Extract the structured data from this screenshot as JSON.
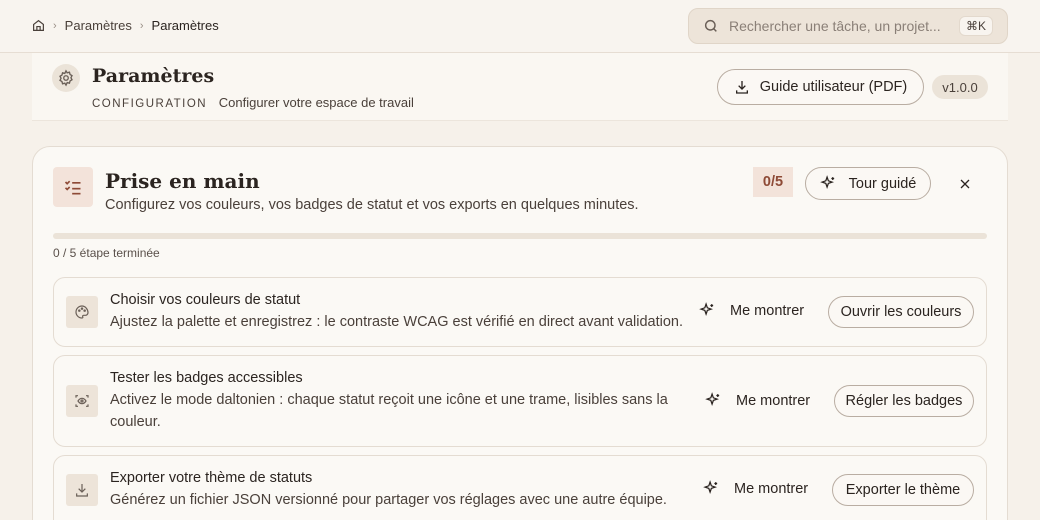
{
  "breadcrumb": {
    "items": [
      "Paramètres",
      "Paramètres"
    ]
  },
  "search": {
    "placeholder": "Rechercher une tâche, un projet...",
    "shortcut": "⌘K"
  },
  "header": {
    "title": "Paramètres",
    "caption": "CONFIGURATION",
    "subtitle": "Configurer votre espace de travail",
    "guide_label": "Guide utilisateur (PDF)",
    "version": "v1.0.0"
  },
  "onboarding": {
    "title": "Prise en main",
    "subtitle": "Configurez vos couleurs, vos badges de statut et vos exports en quelques minutes.",
    "count": "0/5",
    "tour_label": "Tour guidé",
    "progress_fraction": 0,
    "progress_text": "0 / 5 étape terminée",
    "steps": [
      {
        "title": "Choisir vos couleurs de statut",
        "desc": "Ajustez la palette et enregistrez : le contraste WCAG est vérifié en direct avant validation.",
        "show_label": "Me montrer",
        "action_label": "Ouvrir les couleurs",
        "icon": "palette-icon"
      },
      {
        "title": "Tester les badges accessibles",
        "desc": "Activez le mode daltonien : chaque statut reçoit une icône et une trame, lisibles sans la couleur.",
        "show_label": "Me montrer",
        "action_label": "Régler les badges",
        "icon": "scan-eye-icon"
      },
      {
        "title": "Exporter votre thème de statuts",
        "desc": "Générez un fichier JSON versionné pour partager vos réglages avec une autre équipe.",
        "show_label": "Me montrer",
        "action_label": "Exporter le thème",
        "icon": "download-icon"
      }
    ]
  },
  "colors": {
    "accent": "#a85a3f",
    "background": "#f6f1ea",
    "card": "#fbf9f5",
    "badge": "#f3e3da"
  }
}
